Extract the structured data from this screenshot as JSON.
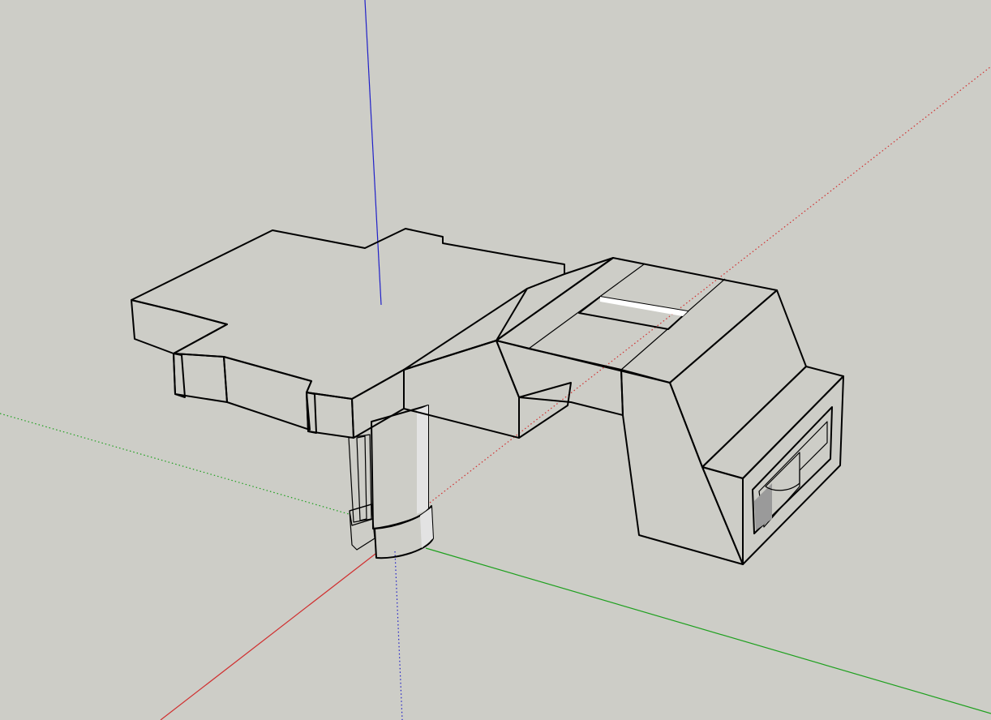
{
  "scene": {
    "background_color": "#cdcdc7",
    "axes": {
      "red_color": "#d03030",
      "green_color": "#1ea01e",
      "blue_color": "#2020c8"
    },
    "model_colors": {
      "top_face": "#c3c3c3",
      "front_face": "#ffffff",
      "side_face": "#e3e3e3",
      "dark_face": "#7c868c",
      "shadow_face": "#9a9a9a",
      "hole_face": "#a9b9c4"
    }
  }
}
